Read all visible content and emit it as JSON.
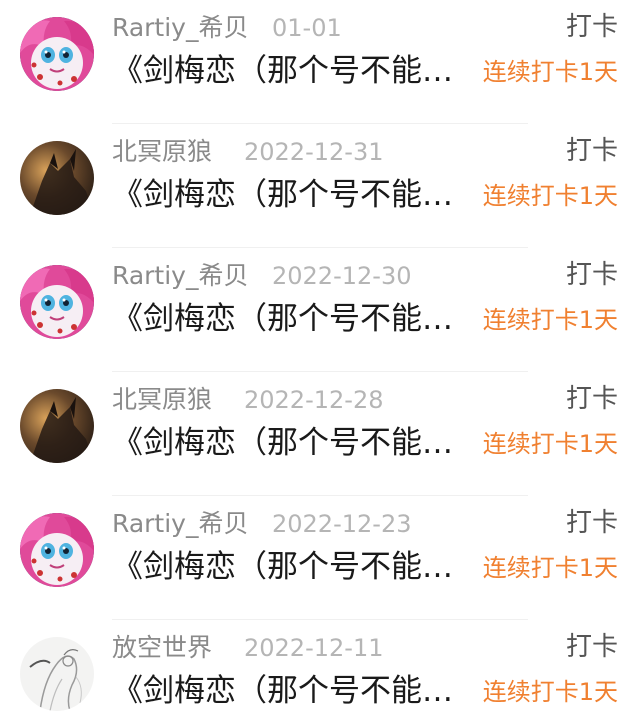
{
  "checkin_list": [
    {
      "user": "Rartiy_希贝",
      "date": "01-01",
      "action": "打卡",
      "title": "《剑梅恋（那个号不能…",
      "streak": "连续打卡1天",
      "avatar": "pony-avatar"
    },
    {
      "user": "北冥原狼",
      "date": "2022-12-31",
      "action": "打卡",
      "title": "《剑梅恋（那个号不能…",
      "streak": "连续打卡1天",
      "avatar": "wolf-avatar"
    },
    {
      "user": "Rartiy_希贝",
      "date": "2022-12-30",
      "action": "打卡",
      "title": "《剑梅恋（那个号不能…",
      "streak": "连续打卡1天",
      "avatar": "pony-avatar"
    },
    {
      "user": "北冥原狼",
      "date": "2022-12-28",
      "action": "打卡",
      "title": "《剑梅恋（那个号不能…",
      "streak": "连续打卡1天",
      "avatar": "wolf-avatar"
    },
    {
      "user": "Rartiy_希贝",
      "date": "2022-12-23",
      "action": "打卡",
      "title": "《剑梅恋（那个号不能…",
      "streak": "连续打卡1天",
      "avatar": "pony-avatar"
    },
    {
      "user": "放空世界",
      "date": "2022-12-11",
      "action": "打卡",
      "title": "《剑梅恋（那个号不能…",
      "streak": "连续打卡1天",
      "avatar": "sketch-avatar"
    }
  ],
  "colors": {
    "username": "#8a8a8a",
    "date": "#b5b5b5",
    "title": "#1a1a1a",
    "action": "#555555",
    "streak": "#f08030"
  }
}
